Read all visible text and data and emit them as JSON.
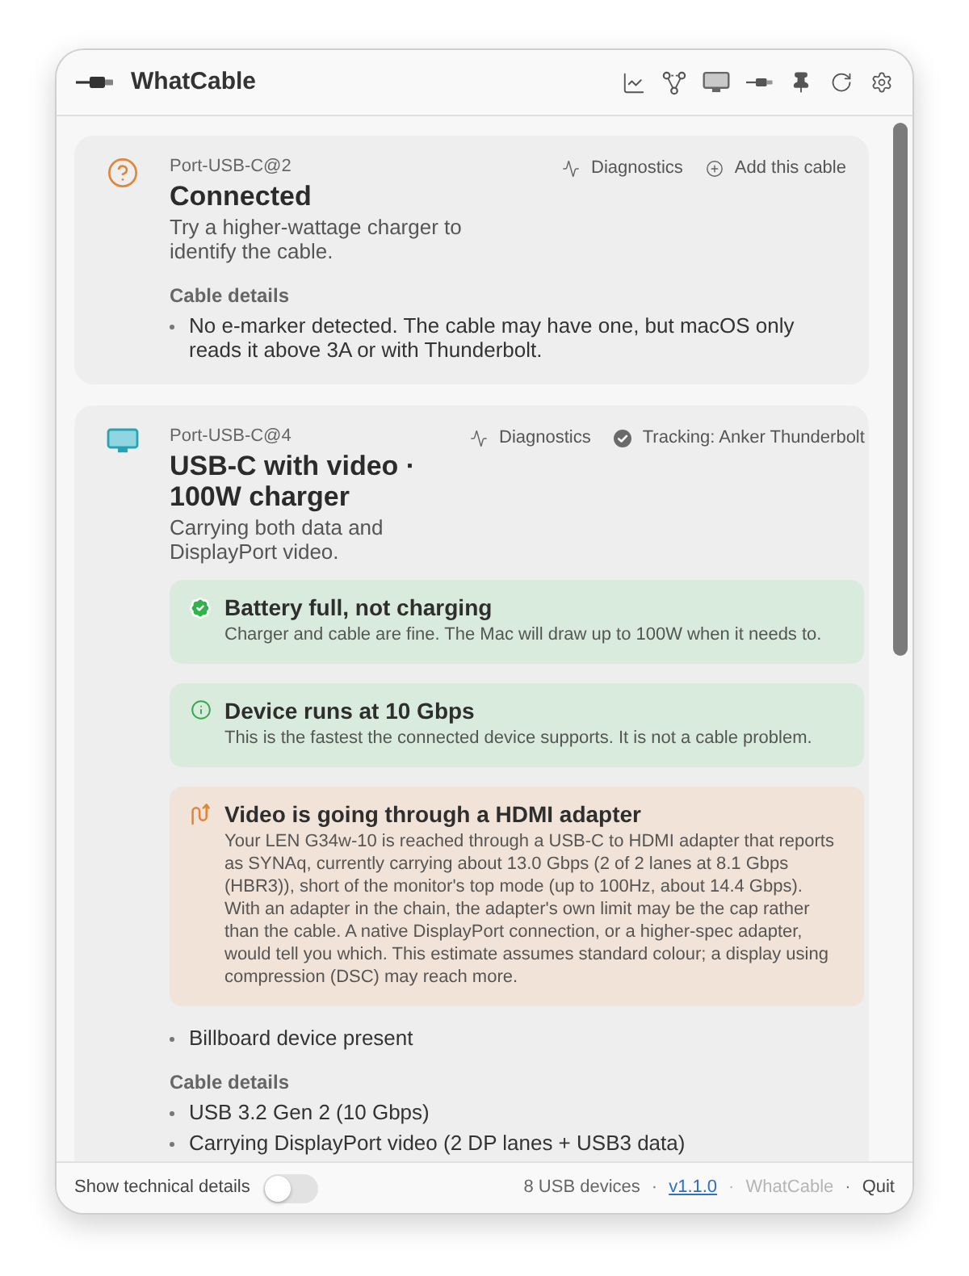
{
  "window": {
    "title": "WhatCable"
  },
  "ports": [
    {
      "kind": "unknown",
      "port": "Port-USB-C@2",
      "title": "Connected",
      "description": "Try a higher-wattage charger to identify the cable.",
      "actions": [
        {
          "kind": "diagnostics",
          "label": "Diagnostics"
        },
        {
          "kind": "add",
          "label": "Add this cable"
        }
      ],
      "sections": [
        {
          "heading": "Cable details",
          "items": [
            "No e-marker detected. The cable may have one, but macOS only reads it above 3A or with Thunderbolt."
          ]
        }
      ]
    },
    {
      "kind": "display",
      "port": "Port-USB-C@4",
      "title": "USB-C with video · 100W charger",
      "description": "Carrying both data and DisplayPort video.",
      "actions": [
        {
          "kind": "diagnostics",
          "label": "Diagnostics"
        },
        {
          "kind": "tracking",
          "label": "Tracking: Anker Thunderbolt"
        }
      ],
      "notices": [
        {
          "kind": "success",
          "title": "Battery full, not charging",
          "body": "Charger and cable are fine. The Mac will draw up to 100W when it needs to."
        },
        {
          "kind": "info",
          "title": "Device runs at 10 Gbps",
          "body": "This is the fastest the connected device supports. It is not a cable problem."
        },
        {
          "kind": "warning",
          "title": "Video is going through a HDMI adapter",
          "body": "Your LEN G34w-10 is reached through a USB-C to HDMI adapter that reports as SYNAq, currently carrying about 13.0 Gbps (2 of 2 lanes at 8.1 Gbps (HBR3)), short of the monitor's top mode (up to 100Hz, about 14.4 Gbps). With an adapter in the chain, the adapter's own limit may be the cap rather than the cable. A native DisplayPort connection, or a higher-spec adapter, would tell you which. This estimate assumes standard colour; a display using compression (DSC) may reach more."
        }
      ],
      "bullets": [
        "Billboard device present"
      ],
      "sections": [
        {
          "heading": "Cable details",
          "items": [
            "USB 3.2 Gen 2 (10 Gbps)",
            "Carrying DisplayPort video (2 DP lanes + USB3 data)"
          ]
        }
      ]
    }
  ],
  "footer": {
    "technical_details": {
      "label": "Show technical details",
      "on": false
    },
    "separator": "·",
    "items": [
      {
        "kind": "count",
        "label": "8 USB devices"
      },
      {
        "kind": "link",
        "label": "v1.1.0"
      },
      {
        "kind": "muted",
        "label": "WhatCable"
      },
      {
        "kind": "action",
        "label": "Quit"
      }
    ]
  }
}
